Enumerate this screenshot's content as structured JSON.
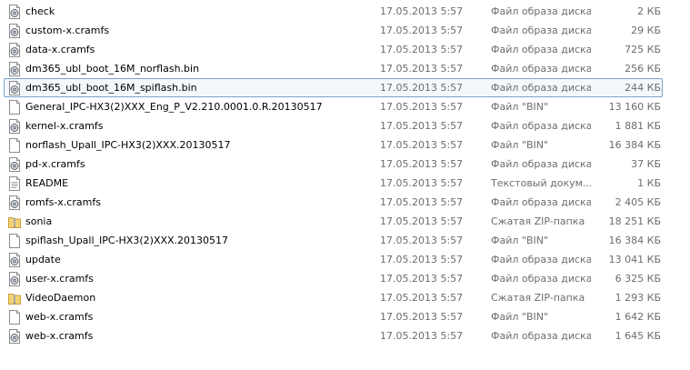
{
  "files": [
    {
      "name": "check",
      "date": "17.05.2013 5:57",
      "type": "Файл образа диска",
      "size": "2 КБ",
      "icon": "disk-image-icon"
    },
    {
      "name": "custom-x.cramfs",
      "date": "17.05.2013 5:57",
      "type": "Файл образа диска",
      "size": "29 КБ",
      "icon": "disk-image-icon"
    },
    {
      "name": "data-x.cramfs",
      "date": "17.05.2013 5:57",
      "type": "Файл образа диска",
      "size": "725 КБ",
      "icon": "disk-image-icon"
    },
    {
      "name": "dm365_ubl_boot_16M_norflash.bin",
      "date": "17.05.2013 5:57",
      "type": "Файл образа диска",
      "size": "256 КБ",
      "icon": "disk-image-icon"
    },
    {
      "name": "dm365_ubl_boot_16M_spiflash.bin",
      "date": "17.05.2013 5:57",
      "type": "Файл образа диска",
      "size": "244 КБ",
      "icon": "disk-image-icon",
      "selected": true
    },
    {
      "name": "General_IPC-HX3(2)XXX_Eng_P_V2.210.0001.0.R.20130517",
      "date": "17.05.2013 5:57",
      "type": "Файл \"BIN\"",
      "size": "13 160 КБ",
      "icon": "bin-file-icon"
    },
    {
      "name": "kernel-x.cramfs",
      "date": "17.05.2013 5:57",
      "type": "Файл образа диска",
      "size": "1 881 КБ",
      "icon": "disk-image-icon"
    },
    {
      "name": "norflash_Upall_IPC-HX3(2)XXX.20130517",
      "date": "17.05.2013 5:57",
      "type": "Файл \"BIN\"",
      "size": "16 384 КБ",
      "icon": "bin-file-icon"
    },
    {
      "name": "pd-x.cramfs",
      "date": "17.05.2013 5:57",
      "type": "Файл образа диска",
      "size": "37 КБ",
      "icon": "disk-image-icon"
    },
    {
      "name": "README",
      "date": "17.05.2013 5:57",
      "type": "Текстовый докум...",
      "size": "1 КБ",
      "icon": "text-document-icon"
    },
    {
      "name": "romfs-x.cramfs",
      "date": "17.05.2013 5:57",
      "type": "Файл образа диска",
      "size": "2 405 КБ",
      "icon": "disk-image-icon"
    },
    {
      "name": "sonia",
      "date": "17.05.2013 5:57",
      "type": "Сжатая ZIP-папка",
      "size": "18 251 КБ",
      "icon": "zip-folder-icon"
    },
    {
      "name": "spiflash_Upall_IPC-HX3(2)XXX.20130517",
      "date": "17.05.2013 5:57",
      "type": "Файл \"BIN\"",
      "size": "16 384 КБ",
      "icon": "bin-file-icon"
    },
    {
      "name": "update",
      "date": "17.05.2013 5:57",
      "type": "Файл образа диска",
      "size": "13 041 КБ",
      "icon": "disk-image-icon"
    },
    {
      "name": "user-x.cramfs",
      "date": "17.05.2013 5:57",
      "type": "Файл образа диска",
      "size": "6 325 КБ",
      "icon": "disk-image-icon"
    },
    {
      "name": "VideoDaemon",
      "date": "17.05.2013 5:57",
      "type": "Сжатая ZIP-папка",
      "size": "1 293 КБ",
      "icon": "zip-folder-icon"
    },
    {
      "name": "web-x.cramfs",
      "date": "17.05.2013 5:57",
      "type": "Файл \"BIN\"",
      "size": "1 642 КБ",
      "icon": "bin-file-icon"
    },
    {
      "name": "web-x.cramfs",
      "date": "17.05.2013 5:57",
      "type": "Файл образа диска",
      "size": "1 645 КБ",
      "icon": "disk-image-icon"
    }
  ],
  "colors": {
    "selection_border": "#7da2ce",
    "selection_fill": "#f4f8fd",
    "secondary_text": "#6d6d6d"
  }
}
